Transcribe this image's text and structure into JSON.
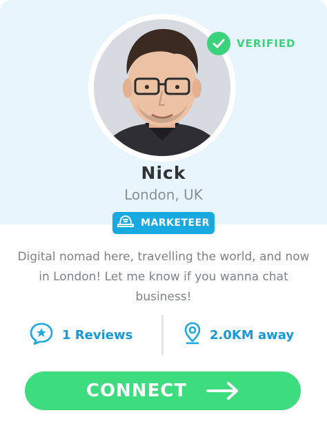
{
  "profile": {
    "name": "Nick",
    "location": "London, UK",
    "verified_label": "VERIFIED",
    "role": "MARKETEER",
    "bio": "Digital nomad here, travelling the world, and now in  London! Let me know if you wanna chat business!"
  },
  "stats": {
    "reviews": "1 Reviews",
    "distance": "2.0KM away"
  },
  "actions": {
    "connect_label": "CONNECT"
  },
  "colors": {
    "accent_green": "#3ad27a",
    "accent_blue": "#17a9e0",
    "stat_blue": "#1799d6",
    "header_bg": "#e8f5fc"
  },
  "icons": {
    "verified": "check-circle-icon",
    "role": "cap-icon",
    "reviews": "star-chat-icon",
    "distance": "map-pin-icon",
    "connect": "arrow-right-icon"
  }
}
